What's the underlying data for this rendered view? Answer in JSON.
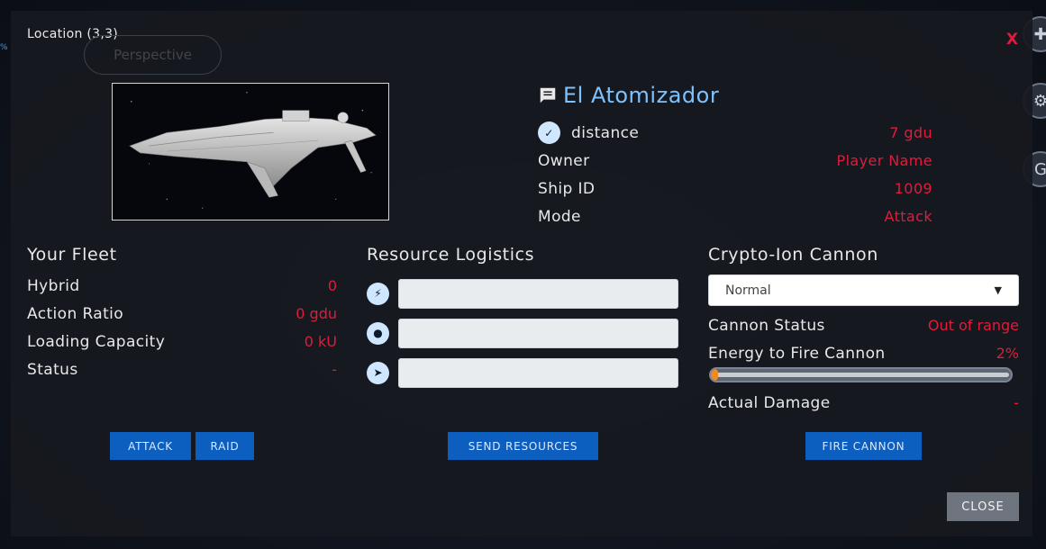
{
  "background": {
    "edge_percent": "%",
    "side_icons": [
      "plus-icon",
      "ship-icon",
      "google-icon"
    ]
  },
  "modal": {
    "location": "Location (3,3)",
    "perspective_label": "Perspective",
    "close_x": "X"
  },
  "ship": {
    "name": "El Atomizador",
    "info": [
      {
        "label": "distance",
        "value": "7 gdu",
        "icon": "distance-icon"
      },
      {
        "label": "Owner",
        "value": "Player Name"
      },
      {
        "label": "Ship ID",
        "value": "1009"
      },
      {
        "label": "Mode",
        "value": "Attack"
      }
    ]
  },
  "fleet": {
    "title": "Your Fleet",
    "rows": [
      {
        "label": "Hybrid",
        "value": "0"
      },
      {
        "label": "Action Ratio",
        "value": "0 gdu"
      },
      {
        "label": "Loading Capacity",
        "value": "0 kU"
      },
      {
        "label": "Status",
        "value": "-"
      }
    ],
    "attack_label": "ATTACK",
    "raid_label": "RAID"
  },
  "resources": {
    "title": "Resource Logistics",
    "inputs": [
      {
        "icon": "energy-icon",
        "value": ""
      },
      {
        "icon": "molecule-icon",
        "value": ""
      },
      {
        "icon": "rocket-icon",
        "value": ""
      }
    ],
    "send_label": "SEND RESOURCES"
  },
  "cannon": {
    "title": "Crypto-Ion Cannon",
    "mode_selected": "Normal",
    "status_label": "Cannon Status",
    "status_value": "Out of range",
    "energy_label": "Energy to Fire Cannon",
    "energy_value": "2%",
    "energy_fraction": 0.02,
    "damage_label": "Actual Damage",
    "damage_value": "-",
    "fire_label": "FIRE CANNON"
  },
  "close_label": "CLOSE",
  "colors": {
    "accent_red": "#e11b3c",
    "ship_name_blue": "#7cc2ff",
    "button_blue": "#0d5fbf",
    "energy_orange": "#f08a24"
  }
}
